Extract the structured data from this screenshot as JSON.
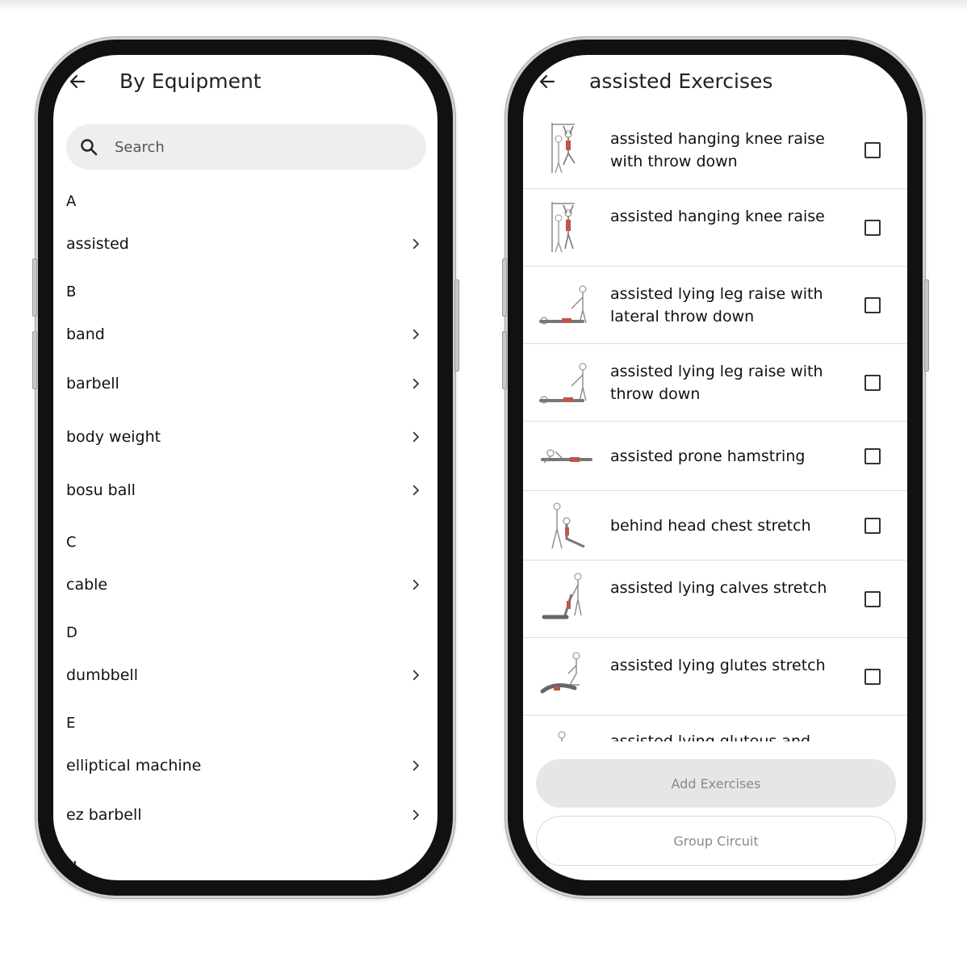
{
  "equipment_screen": {
    "title": "By Equipment",
    "search_placeholder": "Search",
    "sections": [
      {
        "letter": "A",
        "items": [
          "assisted"
        ]
      },
      {
        "letter": "B",
        "items": [
          "band",
          "barbell",
          "body weight",
          "bosu ball"
        ]
      },
      {
        "letter": "C",
        "items": [
          "cable"
        ]
      },
      {
        "letter": "D",
        "items": [
          "dumbbell"
        ]
      },
      {
        "letter": "E",
        "items": [
          "elliptical machine",
          "ez barbell"
        ]
      },
      {
        "letter": "H",
        "items": []
      }
    ]
  },
  "exercises_screen": {
    "title": "assisted Exercises",
    "exercises": [
      {
        "name": "assisted hanging knee raise with throw down",
        "checked": false
      },
      {
        "name": "assisted hanging knee raise",
        "checked": false
      },
      {
        "name": "assisted lying leg raise with lateral throw down",
        "checked": false
      },
      {
        "name": "assisted lying leg raise with throw down",
        "checked": false
      },
      {
        "name": "assisted prone hamstring",
        "checked": false
      },
      {
        "name": "behind head chest stretch",
        "checked": false
      },
      {
        "name": "assisted lying calves stretch",
        "checked": false
      },
      {
        "name": "assisted lying glutes stretch",
        "checked": false
      },
      {
        "name": "assisted lying gluteus and",
        "checked": false
      }
    ],
    "add_button_label": "Add Exercises",
    "group_button_label": "Group Circuit"
  }
}
